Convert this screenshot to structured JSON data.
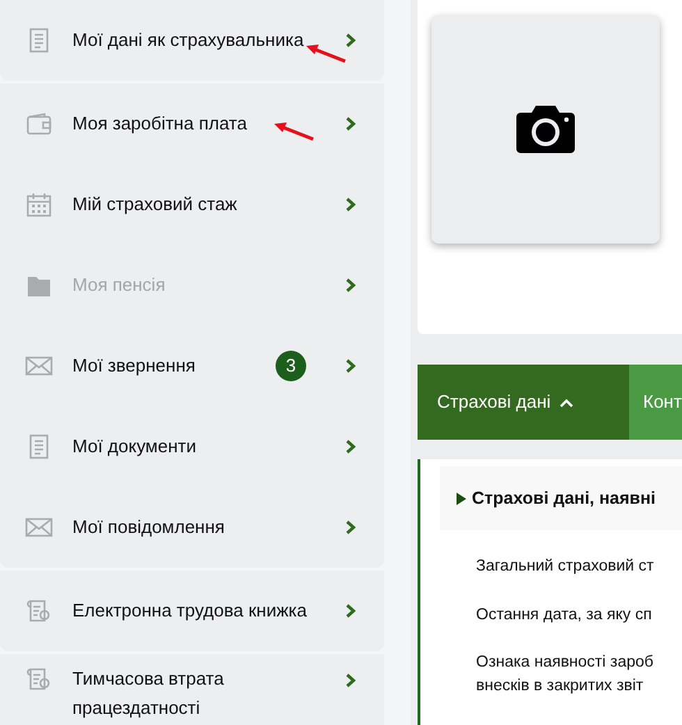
{
  "sidebar": {
    "groups": [
      {
        "items": [
          {
            "label": "Мої дані як страхувальника",
            "disabled": false,
            "annotated": true
          }
        ]
      },
      {
        "items": [
          {
            "label": "Моя заробітна плата",
            "disabled": false,
            "annotated": true
          },
          {
            "label": "Мій страховий стаж",
            "disabled": false,
            "annotated": false
          },
          {
            "label": "Моя пенсія",
            "disabled": true,
            "annotated": false
          },
          {
            "label": "Мої звернення",
            "disabled": false,
            "annotated": false,
            "badge": "3"
          },
          {
            "label": "Мої документи",
            "disabled": false,
            "annotated": false
          },
          {
            "label": "Мої повідомлення",
            "disabled": false,
            "annotated": false
          }
        ]
      },
      {
        "items": [
          {
            "label": "Електронна трудова книжка",
            "disabled": false,
            "annotated": false
          }
        ]
      },
      {
        "items": [
          {
            "label": "Тимчасова втрата працездатності",
            "disabled": false,
            "annotated": false
          }
        ]
      }
    ]
  },
  "photo": {
    "kind": "camera"
  },
  "tabs": [
    {
      "label": "Страхові дані",
      "selected": true,
      "expanded": true
    },
    {
      "label": "Конт",
      "selected": false
    }
  ],
  "section": {
    "title": "Страхові дані, наявні",
    "expanded": false,
    "rows": [
      "Загальний страховий ст",
      "Остання дата, за яку сп",
      "Ознака наявності зароб\nвнесків в закритих звіт"
    ]
  }
}
